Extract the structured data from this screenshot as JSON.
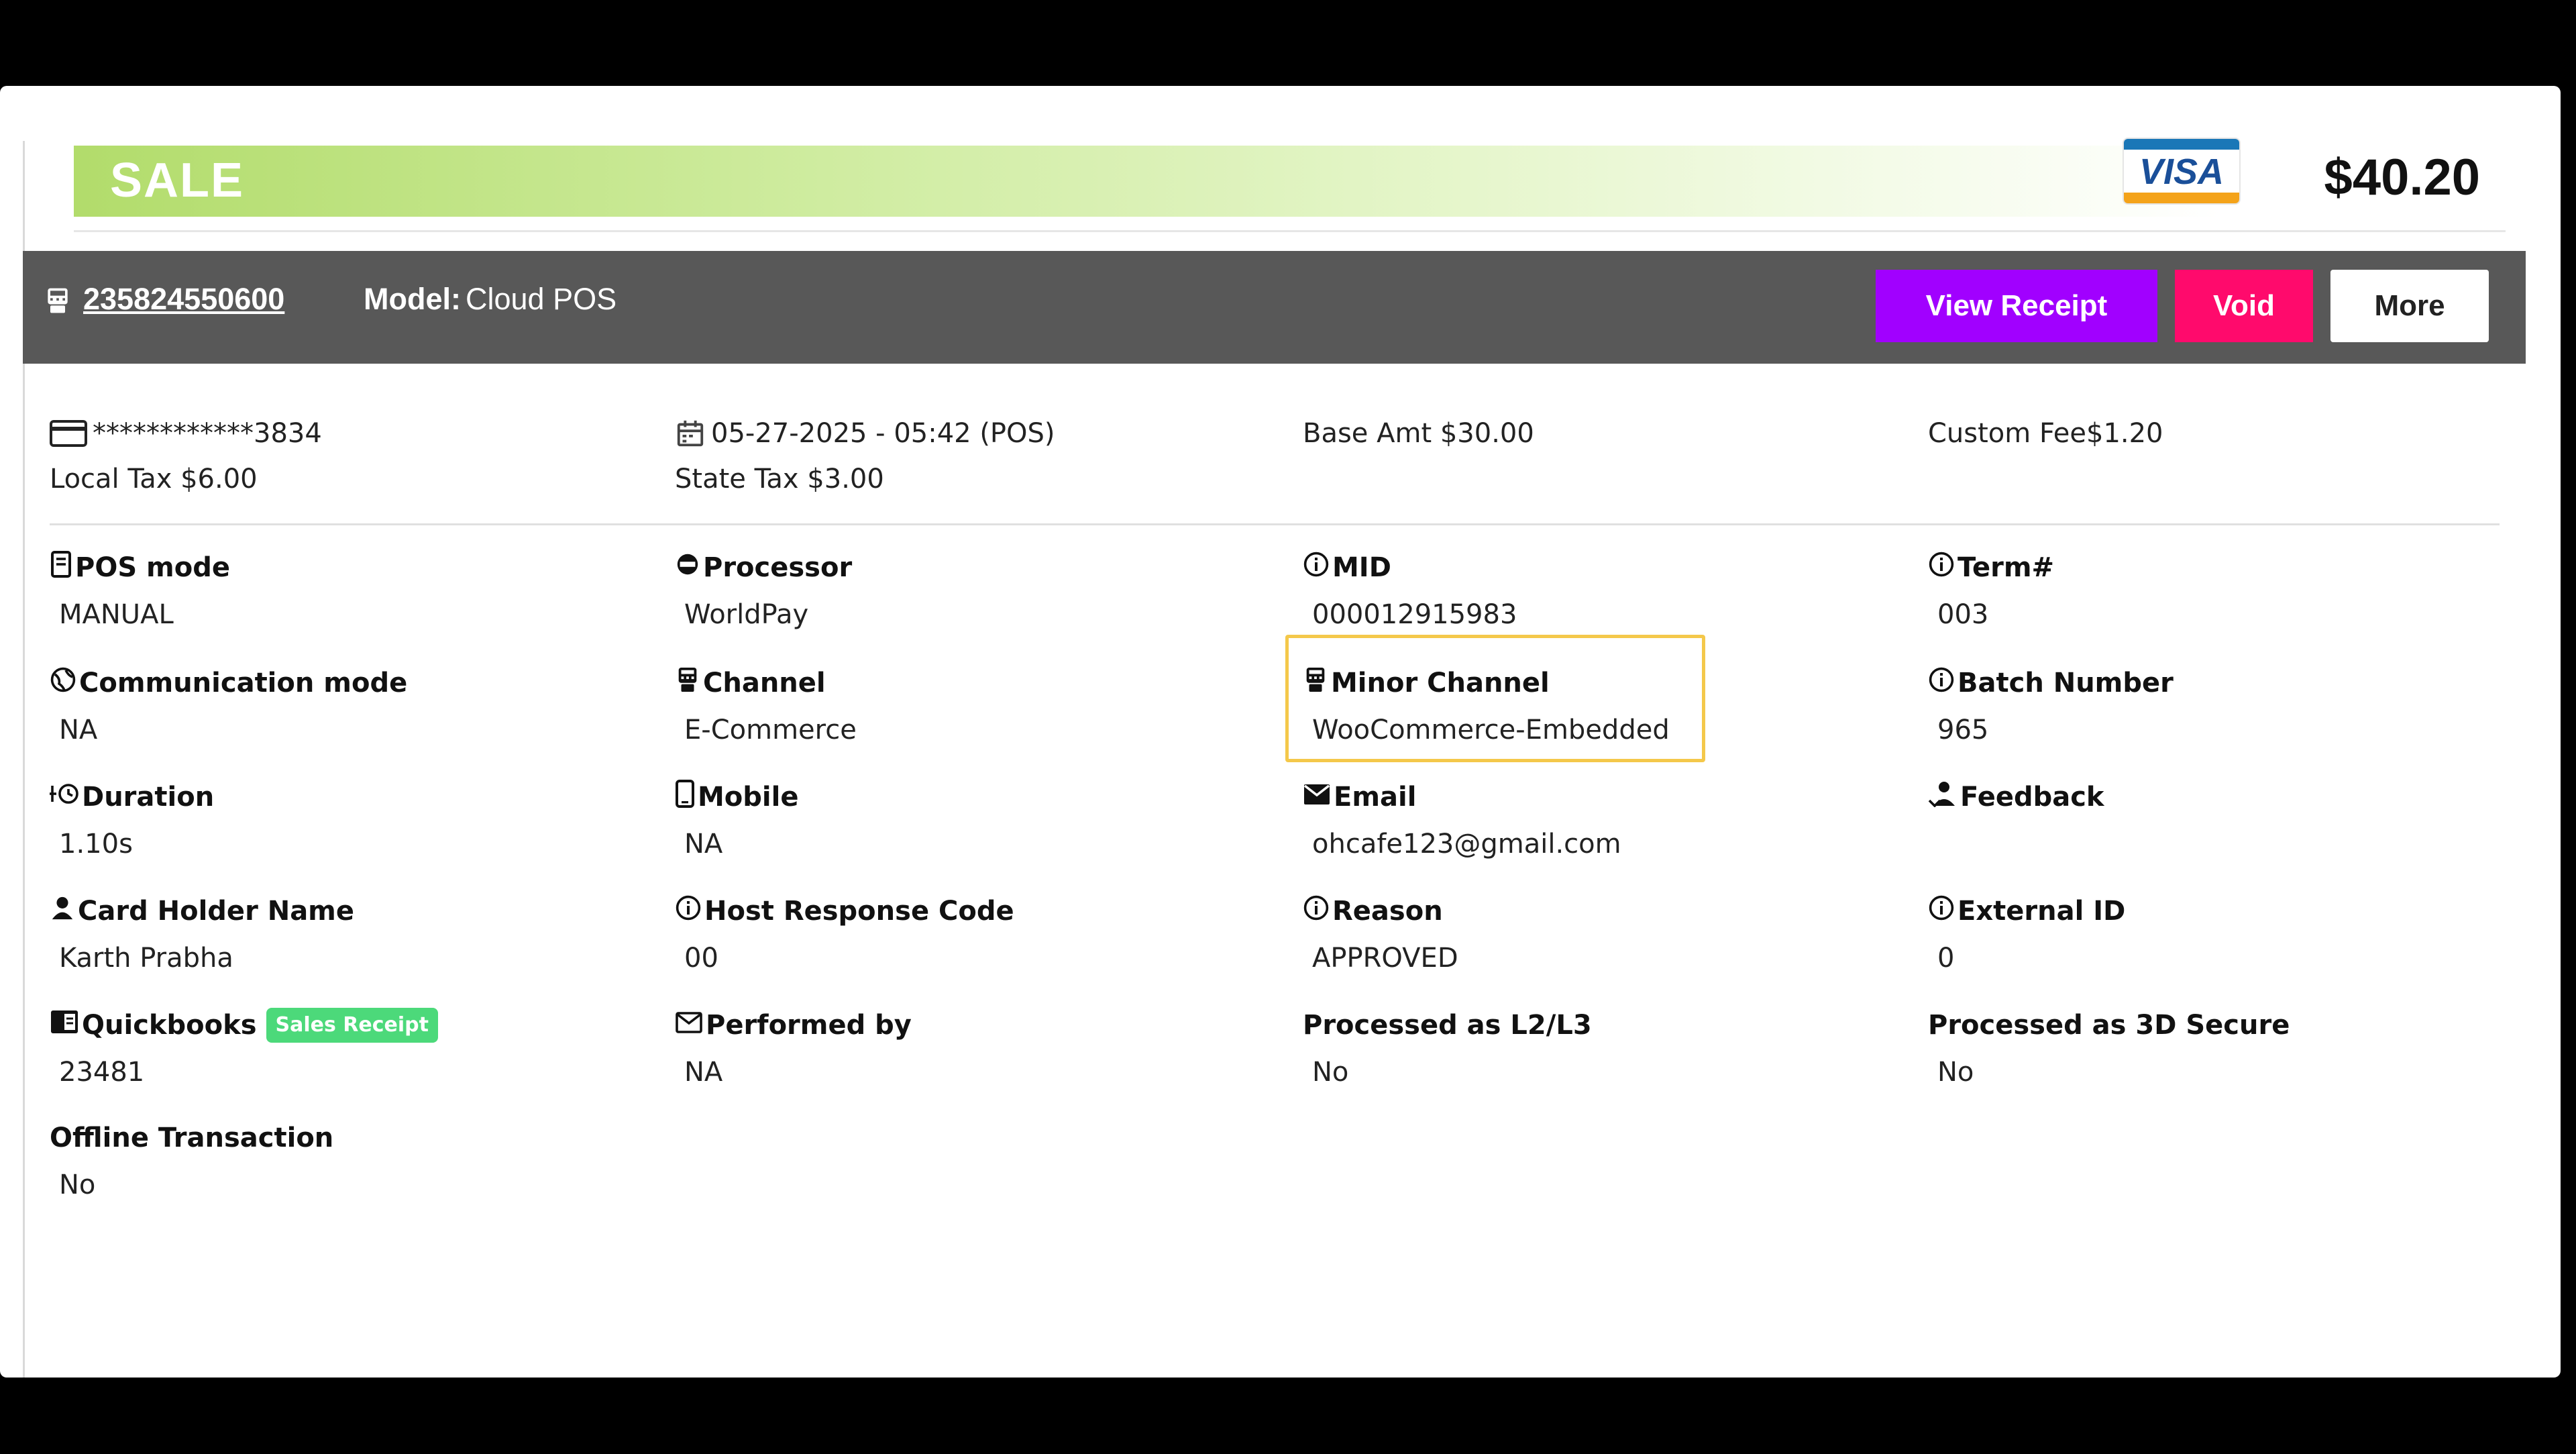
{
  "sale": {
    "label": "SALE",
    "card_brand": "VISA",
    "amount": "$40.20"
  },
  "header": {
    "transaction_id": "235824550600",
    "model_label": "Model:",
    "model_value": "Cloud POS",
    "buttons": {
      "view_receipt": "View Receipt",
      "void": "Void",
      "more": "More"
    }
  },
  "summary": {
    "card_number": "************3834",
    "local_tax": "Local Tax $6.00",
    "datetime": "05-27-2025 - 05:42 (POS)",
    "state_tax": "State Tax $3.00",
    "base_amt": "Base Amt $30.00",
    "custom_fee": "Custom Fee$1.20"
  },
  "fields": [
    {
      "label": "POS mode",
      "value": "MANUAL",
      "icon": "receipt-icon"
    },
    {
      "label": "Processor",
      "value": "WorldPay",
      "icon": "processor-icon"
    },
    {
      "label": "MID",
      "value": "000012915983",
      "icon": "info-icon"
    },
    {
      "label": "Term#",
      "value": "003",
      "icon": "info-icon"
    },
    {
      "label": "Communication mode",
      "value": "NA",
      "icon": "globe-icon"
    },
    {
      "label": "Channel",
      "value": "E-Commerce",
      "icon": "terminal-icon"
    },
    {
      "label": "Minor Channel",
      "value": "WooCommerce-Embedded",
      "icon": "terminal-icon"
    },
    {
      "label": "Batch Number",
      "value": "965",
      "icon": "info-icon"
    },
    {
      "label": "Duration",
      "value": "1.10s",
      "icon": "timer-icon"
    },
    {
      "label": "Mobile",
      "value": "NA",
      "icon": "mobile-icon"
    },
    {
      "label": "Email",
      "value": "ohcafe123@gmail.com",
      "icon": "email-icon"
    },
    {
      "label": "Feedback",
      "value": "",
      "icon": "feedback-icon"
    },
    {
      "label": "Card Holder Name",
      "value": "Karth Prabha",
      "icon": "person-icon"
    },
    {
      "label": "Host Response Code",
      "value": "00",
      "icon": "info-icon"
    },
    {
      "label": "Reason",
      "value": "APPROVED",
      "icon": "info-icon"
    },
    {
      "label": "External ID",
      "value": "0",
      "icon": "info-icon"
    },
    {
      "label": "Quickbooks",
      "value": "23481",
      "icon": "book-icon",
      "badge": "Sales Receipt"
    },
    {
      "label": "Performed by",
      "value": "NA",
      "icon": "envelope-outline-icon"
    },
    {
      "label": "Processed as L2/L3",
      "value": "No",
      "icon": ""
    },
    {
      "label": "Processed as 3D Secure",
      "value": "No",
      "icon": ""
    },
    {
      "label": "Offline Transaction",
      "value": "No",
      "icon": ""
    }
  ],
  "colors": {
    "sale_band": "#b2dc6b",
    "header_bar": "#585858",
    "view_receipt": "#a100ff",
    "void": "#ff0a6c",
    "highlight": "#f4c84a",
    "badge": "#4cd97a"
  }
}
